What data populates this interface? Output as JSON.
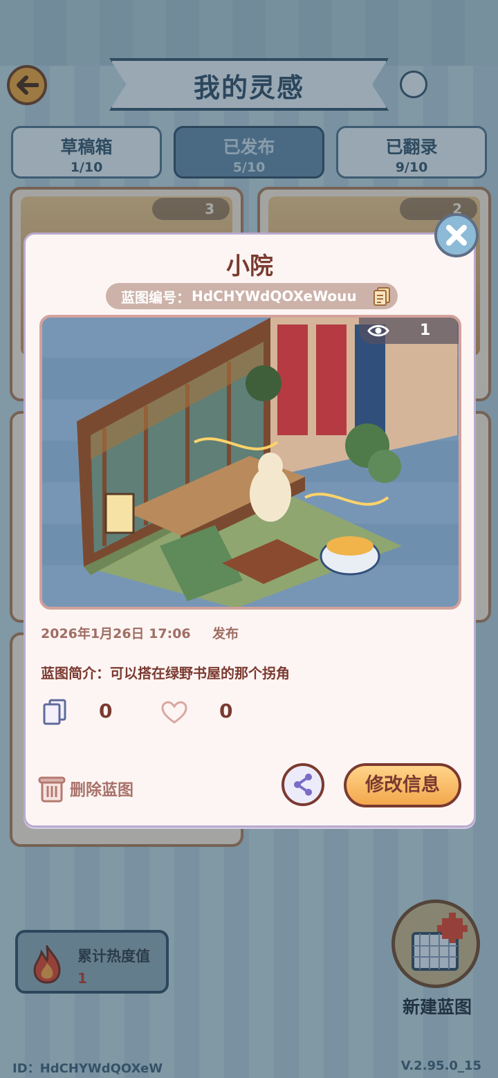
{
  "header": {
    "title": "我的灵感"
  },
  "tabs": [
    {
      "label": "草稿箱",
      "count": "1/10"
    },
    {
      "label": "已发布",
      "count": "5/10"
    },
    {
      "label": "已翻录",
      "count": "9/10"
    }
  ],
  "background_cards": [
    {
      "views": "3"
    },
    {
      "views": "2"
    }
  ],
  "heat": {
    "label": "累计热度值",
    "value": "1"
  },
  "new_blueprint": {
    "label": "新建蓝图"
  },
  "footer": {
    "id_text": "ID：HdCHYWdQOXeW",
    "version": "V.2.95.0_15"
  },
  "modal": {
    "title": "小院",
    "code_label": "蓝图编号：",
    "code_value": "HdCHYWdQOXeWouu",
    "views": "1",
    "date": "2026年1月26日 17:06",
    "status": "发布",
    "description_label": "蓝图简介：",
    "description": "可以搭在绿野书屋的那个拐角",
    "copies": "0",
    "likes": "0",
    "delete_label": "删除蓝图",
    "edit_label": "修改信息"
  },
  "colors": {
    "accent": "#7a3a30",
    "tab_active": "#5f87a6",
    "edit_button": "#f3a74c",
    "modal_bg": "#fdf5f3"
  }
}
